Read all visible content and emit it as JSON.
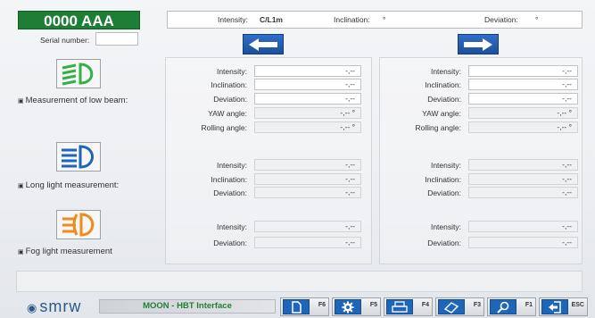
{
  "header": {
    "plate": "0000 AAA",
    "serial_label": "Serial number:",
    "serial_value": ""
  },
  "status": {
    "intensity_label": "Intensity:",
    "intensity_value": "C/L1m",
    "inclination_label": "Inclination:",
    "inclination_value": "°",
    "deviation_label": "Deviation:",
    "deviation_value": "°"
  },
  "sections": {
    "low_beam": {
      "label": "Measurement of low beam:",
      "check": "▣",
      "rows": [
        {
          "label": "Intensity:",
          "left": "-,--",
          "right": "-,--"
        },
        {
          "label": "Inclination:",
          "left": "-,--",
          "right": "-,--"
        },
        {
          "label": "Deviation:",
          "left": "-,--",
          "right": "-,--"
        },
        {
          "label": "YAW angle:",
          "left": "-,-- °",
          "right": "-,-- °"
        },
        {
          "label": "Rolling angle:",
          "left": "-,-- °",
          "right": "-,-- °"
        }
      ]
    },
    "long_light": {
      "label": "Long light measurement:",
      "check": "▣",
      "rows": [
        {
          "label": "Intensity:",
          "left": "-,--",
          "right": "-,--"
        },
        {
          "label": "Inclination:",
          "left": "-,--",
          "right": "-,--"
        },
        {
          "label": "Deviation:",
          "left": "-,--",
          "right": "-,--"
        }
      ]
    },
    "fog_light": {
      "label": "Fog light measurement",
      "check": "▣",
      "rows": [
        {
          "label": "Intensity:",
          "left": "-,--",
          "right": "-,--"
        },
        {
          "label": "Deviation:",
          "left": "-,--",
          "right": "-,--"
        }
      ]
    }
  },
  "footer": {
    "logo": "smrw",
    "logo_mark": "◉",
    "app_name": "MOON - HBT Interface",
    "keys": [
      {
        "icon": "document-icon",
        "label": "F6"
      },
      {
        "icon": "gear-icon",
        "label": "F5"
      },
      {
        "icon": "printer-icon",
        "label": "F4"
      },
      {
        "icon": "eraser-icon",
        "label": "F3"
      },
      {
        "icon": "search-icon",
        "label": "F1"
      },
      {
        "icon": "exit-icon",
        "label": "ESC"
      }
    ]
  },
  "colors": {
    "plate_bg": "#1e7e36",
    "accent_blue": "#1f66b8",
    "low_beam_green": "#34b04a",
    "long_light_blue": "#1f66b8",
    "fog_orange": "#f08a1c"
  }
}
